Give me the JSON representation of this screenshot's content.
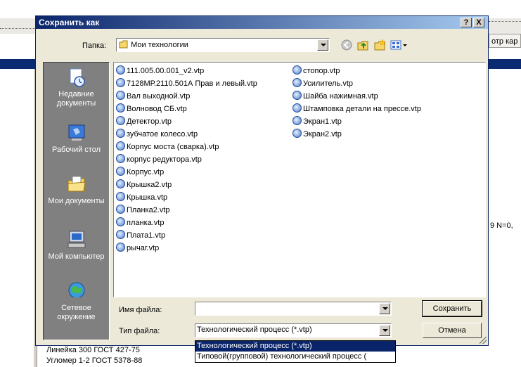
{
  "dialog": {
    "title": "Сохранить как",
    "help_button": "?",
    "close_button": "X",
    "folder_label": "Папка:",
    "folder_value": "Мои технологии",
    "filename_label": "Имя файла:",
    "filename_value": "",
    "filetype_label": "Тип файла:",
    "filetype_value": "Технологический процесс (*.vtp)",
    "save_button": "Сохранить",
    "cancel_button": "Отмена"
  },
  "places": [
    {
      "label": "Недавние документы",
      "icon": "recent-documents-icon"
    },
    {
      "label": "Рабочий стол",
      "icon": "desktop-icon"
    },
    {
      "label": "Мои документы",
      "icon": "my-documents-icon"
    },
    {
      "label": "Мой компьютер",
      "icon": "my-computer-icon"
    },
    {
      "label": "Сетевое окружение",
      "icon": "network-icon"
    }
  ],
  "files_col1": [
    "111.005.00.001_v2.vtp",
    "7128МР.2110.501А Прав и левый.vtp",
    "Вал выходной.vtp",
    "Волновод СБ.vtp",
    "Детектор.vtp",
    "зубчатое колесо.vtp",
    "Корпус моста (сварка).vtp",
    "корпус редуктора.vtp",
    "Корпус.vtp",
    "Крышка2.vtp",
    "Крышка.vtp",
    "Планка2.vtp",
    "планка.vtp",
    "Плата1.vtp",
    "рычаг.vtp"
  ],
  "files_col2": [
    "стопор.vtp",
    "Усилитель.vtp",
    "Шайба нажимная.vtp",
    "Штамповка детали на прессе.vtp",
    "Экран1.vtp",
    "Экран2.vtp"
  ],
  "filetype_options": [
    "Технологический процесс (*.vtp)",
    "Типовой(групповой) технологический процесс ("
  ],
  "background": {
    "right_tab": "отр кар",
    "right_text": "9  N=0,",
    "bottom_line1": "Линейка 300  ГОСТ 427-75",
    "bottom_line2": "Угломер 1-2  ГОСТ 5378-88"
  }
}
